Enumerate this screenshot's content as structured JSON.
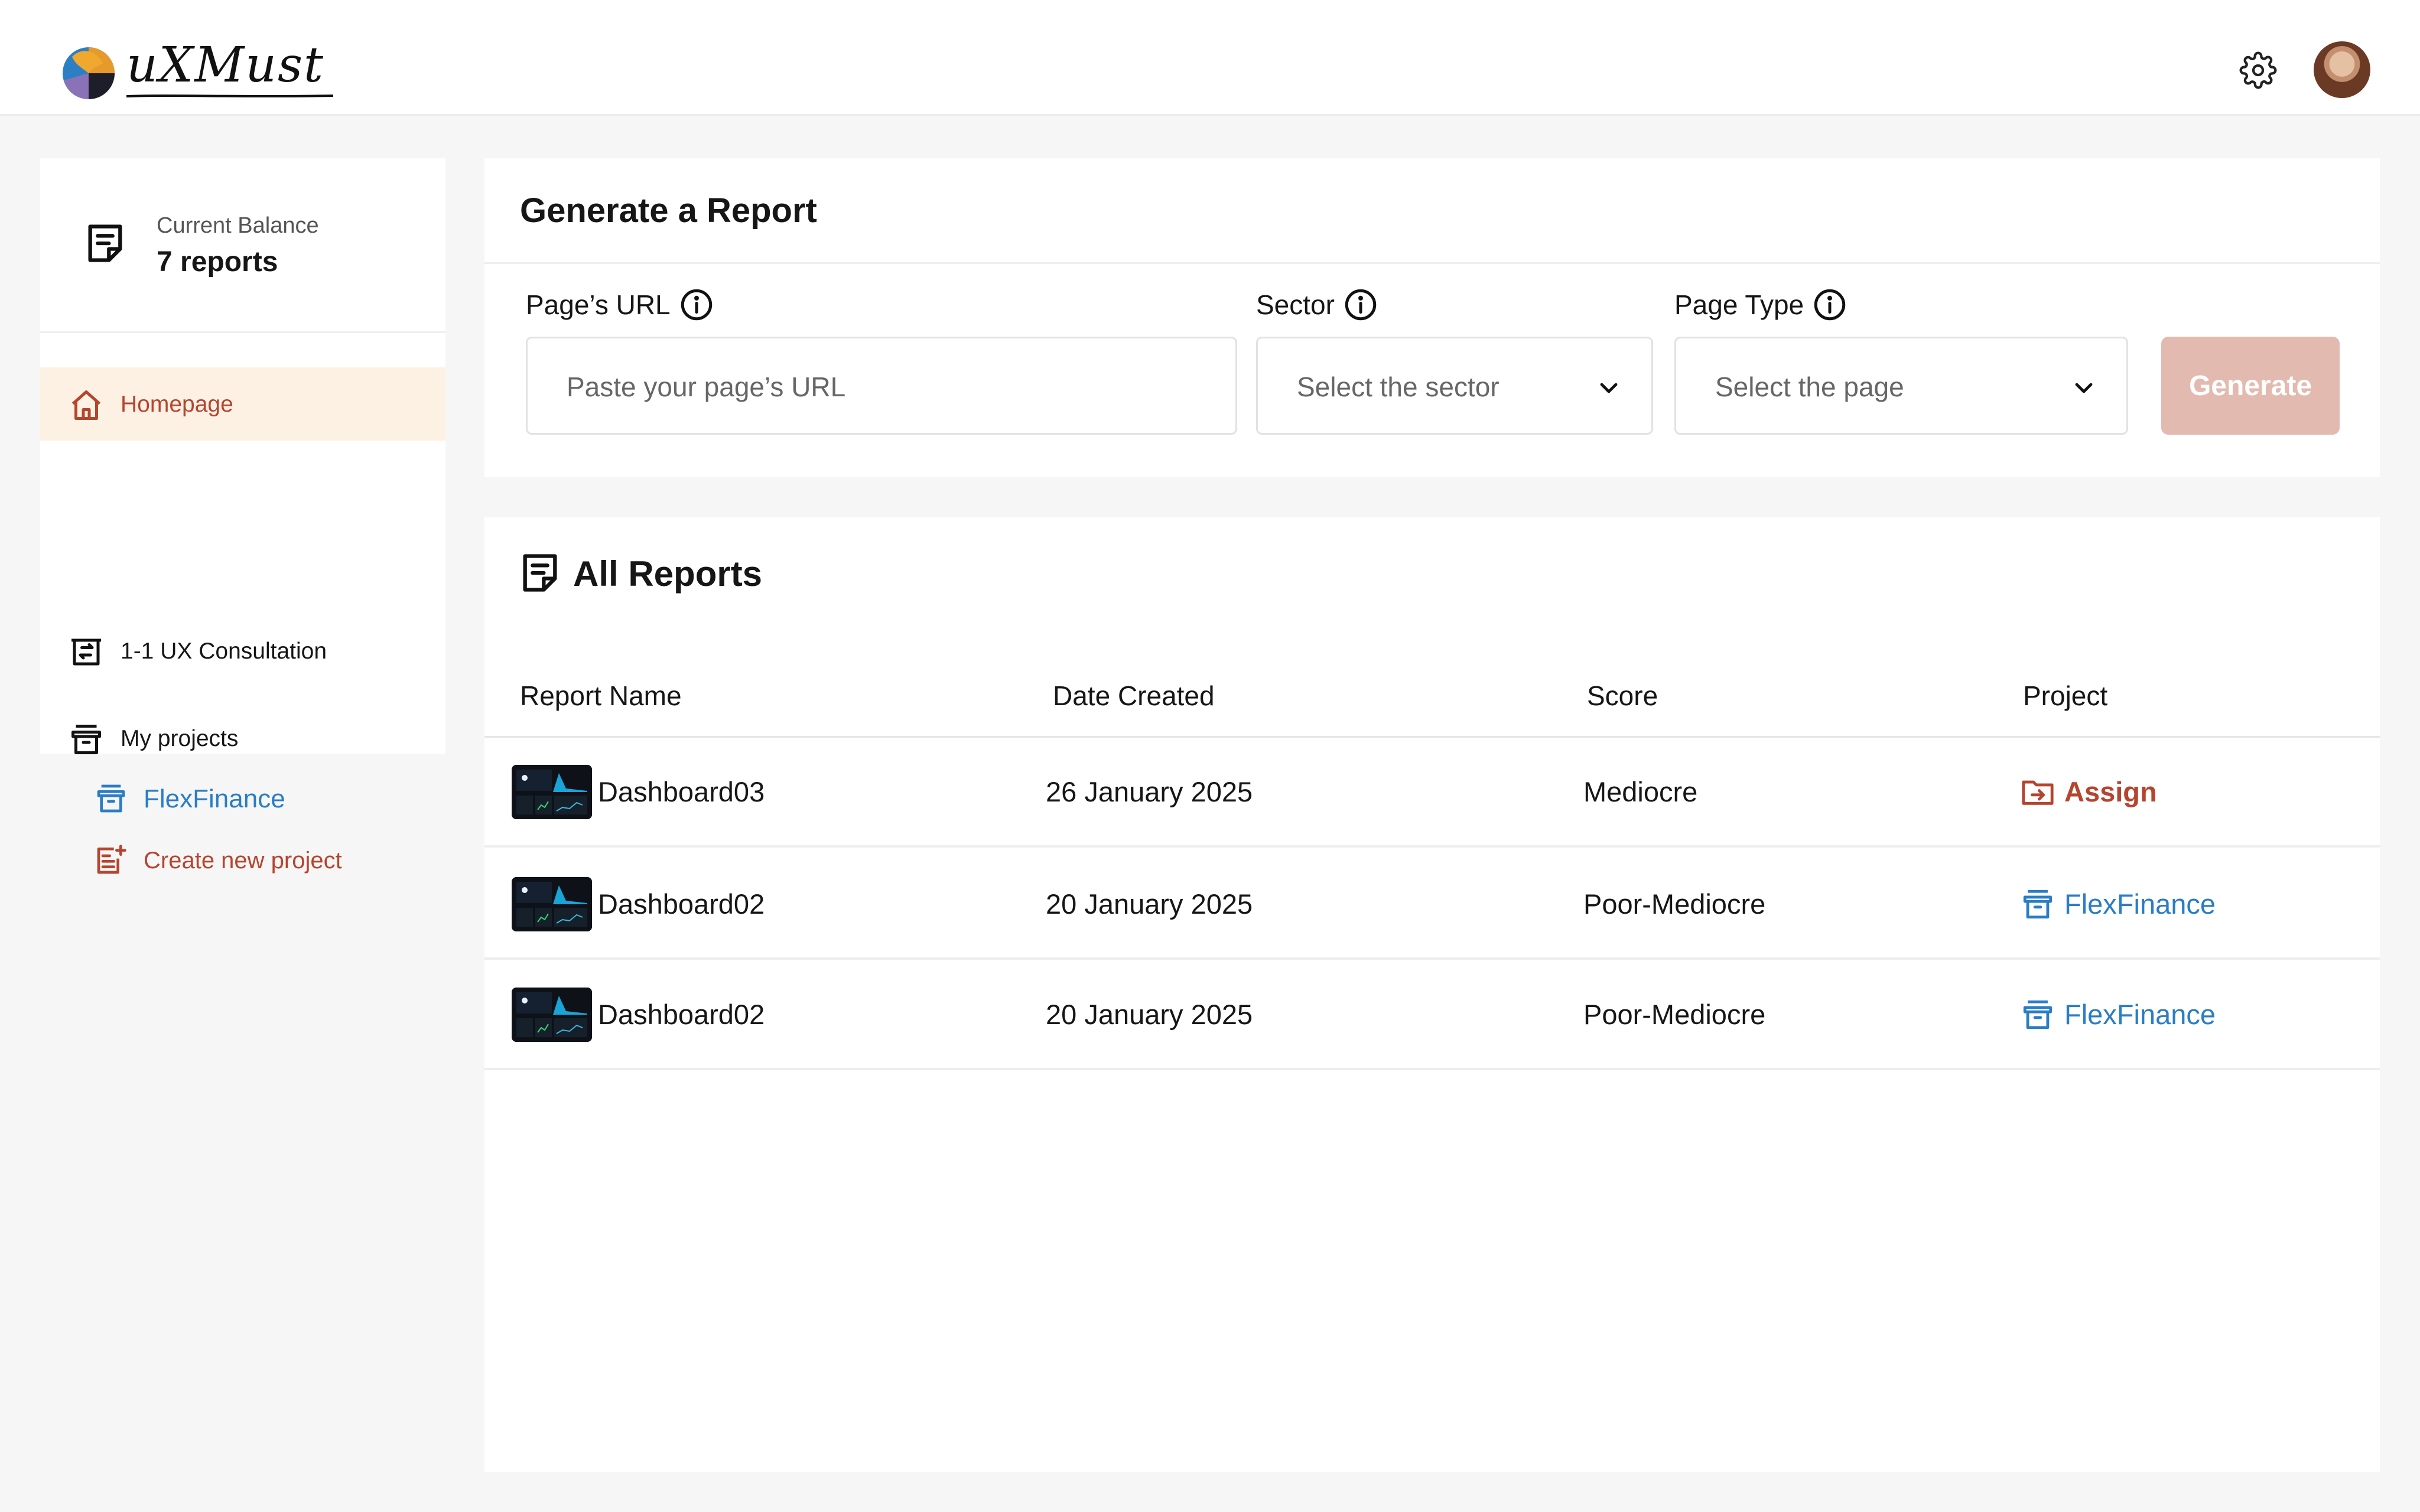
{
  "app": {
    "logo_text": "uXMust"
  },
  "sidebar": {
    "balance_label": "Current Balance",
    "balance_value": "7 reports",
    "nav": [
      {
        "label": "Homepage",
        "icon": "home-icon",
        "active": true
      },
      {
        "label": "1-1 UX Consultation",
        "icon": "consultation-icon",
        "active": false
      },
      {
        "label": "My projects",
        "icon": "archive-box-icon",
        "active": false
      }
    ],
    "projects": [
      {
        "label": "FlexFinance",
        "icon": "archive-box-icon"
      }
    ],
    "create_project_label": "Create new project"
  },
  "generate": {
    "title": "Generate a Report",
    "url_label": "Page’s URL",
    "url_placeholder": "Paste your page’s URL",
    "sector_label": "Sector",
    "sector_placeholder": "Select the sector",
    "type_label": "Page Type",
    "type_placeholder": "Select the page",
    "button_label": "Generate"
  },
  "reports": {
    "title": "All Reports",
    "columns": [
      "Report Name",
      "Date Created",
      "Score",
      "Project"
    ],
    "rows": [
      {
        "name": "Dashboard03",
        "date": "26 January 2025",
        "score": "Mediocre",
        "project": "Assign",
        "project_kind": "assign"
      },
      {
        "name": "Dashboard02",
        "date": "20 January 2025",
        "score": "Poor-Mediocre",
        "project": "FlexFinance",
        "project_kind": "project"
      },
      {
        "name": "Dashboard02",
        "date": "20 January 2025",
        "score": "Poor-Mediocre",
        "project": "FlexFinance",
        "project_kind": "project"
      }
    ]
  },
  "colors": {
    "accent": "#b5452f",
    "link_blue": "#2a7dc4",
    "active_bg": "#fdf1e4",
    "button_disabled": "#e3bab0"
  }
}
